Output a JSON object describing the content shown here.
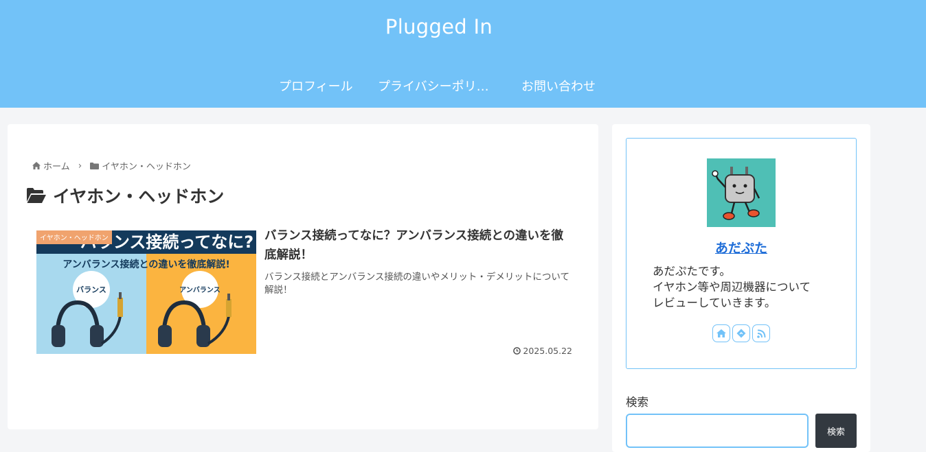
{
  "header": {
    "site_title": "Plugged In",
    "nav": [
      "プロフィール",
      "プライバシーポリシー",
      "お問い合わせ"
    ],
    "background_color": "#72c2f8"
  },
  "breadcrumb": {
    "home": "ホーム",
    "category": "イヤホン・ヘッドホン"
  },
  "archive_title": "イヤホン・ヘッドホン",
  "entries": [
    {
      "category": "イヤホン・ヘッドホン",
      "title": "バランス接続ってなに？アンバランス接続との違いを徹底解説！",
      "snippet": "バランス接続とアンバランス接続の違いやメリット・デメリットについて解説！",
      "date": "2025.05.22",
      "thumbnail": {
        "headline": "バランス接続ってなに?",
        "subheadline": "アンバランス接続との違いを徹底解説!",
        "left_label": "バランス",
        "right_label": "アンバランス"
      }
    }
  ],
  "profile": {
    "name": "あだぷた",
    "description": [
      "あだぷたです。",
      "イヤホン等や周辺機器について",
      "レビューしていきます。"
    ],
    "social_icons": [
      "home-icon",
      "feedly-icon",
      "rss-icon"
    ]
  },
  "search": {
    "label": "検索",
    "button": "検索",
    "value": ""
  }
}
